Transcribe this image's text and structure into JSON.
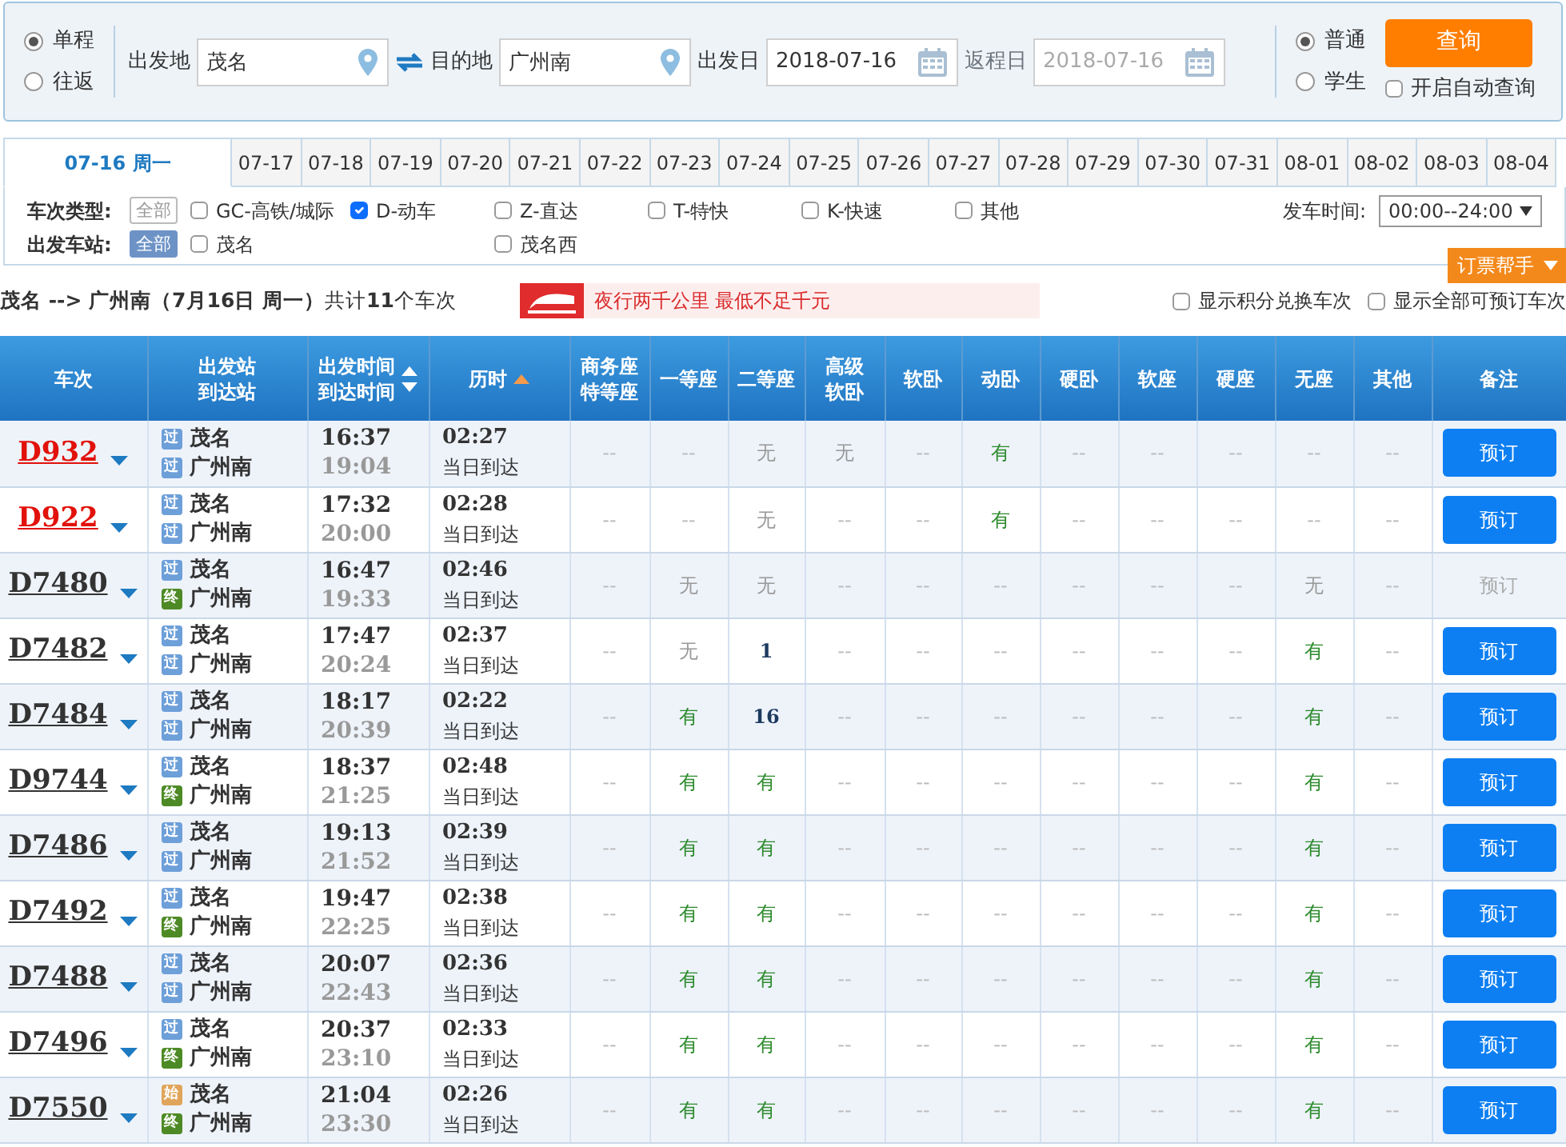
{
  "trip_type": [
    {
      "label": "单程",
      "selected": true
    },
    {
      "label": "往返",
      "selected": false
    }
  ],
  "search": {
    "from_label": "出发地",
    "from_value": "茂名",
    "to_label": "目的地",
    "to_value": "广州南",
    "depart_label": "出发日",
    "depart_value": "2018-07-16",
    "return_label": "返程日",
    "return_value": "2018-07-16",
    "return_disabled": true
  },
  "passenger_type": [
    {
      "label": "普通",
      "selected": true
    },
    {
      "label": "学生",
      "selected": false
    }
  ],
  "query_button": "查询",
  "auto_query": {
    "label": "开启自动查询",
    "checked": false
  },
  "date_tabs": [
    {
      "label": "07-16 周一",
      "selected": true
    },
    {
      "label": "07-17",
      "selected": false
    },
    {
      "label": "07-18",
      "selected": false
    },
    {
      "label": "07-19",
      "selected": false
    },
    {
      "label": "07-20",
      "selected": false
    },
    {
      "label": "07-21",
      "selected": false
    },
    {
      "label": "07-22",
      "selected": false
    },
    {
      "label": "07-23",
      "selected": false
    },
    {
      "label": "07-24",
      "selected": false
    },
    {
      "label": "07-25",
      "selected": false
    },
    {
      "label": "07-26",
      "selected": false
    },
    {
      "label": "07-27",
      "selected": false
    },
    {
      "label": "07-28",
      "selected": false
    },
    {
      "label": "07-29",
      "selected": false
    },
    {
      "label": "07-30",
      "selected": false
    },
    {
      "label": "07-31",
      "selected": false
    },
    {
      "label": "08-01",
      "selected": false
    },
    {
      "label": "08-02",
      "selected": false
    },
    {
      "label": "08-03",
      "selected": false
    },
    {
      "label": "08-04",
      "selected": false
    }
  ],
  "train_filter": {
    "label": "车次类型:",
    "all": {
      "label": "全部",
      "selected": false
    },
    "options": [
      {
        "label": "GC-高铁/城际",
        "checked": false
      },
      {
        "label": "D-动车",
        "checked": true
      },
      {
        "label": "Z-直达",
        "checked": false
      },
      {
        "label": "T-特快",
        "checked": false
      },
      {
        "label": "K-快速",
        "checked": false
      },
      {
        "label": "其他",
        "checked": false
      }
    ]
  },
  "depart_time": {
    "label": "发车时间:",
    "value": "00:00--24:00"
  },
  "station_filter": {
    "label": "出发车站:",
    "all": {
      "label": "全部",
      "selected": true
    },
    "options": [
      {
        "label": "茂名",
        "checked": false
      },
      {
        "label": "茂名西",
        "checked": false
      }
    ]
  },
  "helper_button": "订票帮手",
  "summary": "**茂名 --> 广州南（7月16日  周一）**共计**11**个车次",
  "promo": "夜行两千公里 最低不足千元",
  "display_options": [
    {
      "label": "显示积分兑换车次",
      "checked": false
    },
    {
      "label": "显示全部可预订车次",
      "checked": false
    }
  ],
  "table": {
    "columns": [
      {
        "lines": [
          "车次"
        ]
      },
      {
        "lines": [
          "出发站",
          "到达站"
        ]
      },
      {
        "lines": [
          "出发时间",
          "到达时间"
        ],
        "kind": "sort_both"
      },
      {
        "lines": [
          "历时"
        ],
        "kind": "sort_asc"
      },
      {
        "lines": [
          "商务座",
          "特等座"
        ]
      },
      {
        "lines": [
          "一等座"
        ]
      },
      {
        "lines": [
          "二等座"
        ]
      },
      {
        "lines": [
          "高级",
          "软卧"
        ]
      },
      {
        "lines": [
          "软卧"
        ]
      },
      {
        "lines": [
          "动卧"
        ]
      },
      {
        "lines": [
          "硬卧"
        ]
      },
      {
        "lines": [
          "软座"
        ]
      },
      {
        "lines": [
          "硬座"
        ]
      },
      {
        "lines": [
          "无座"
        ]
      },
      {
        "lines": [
          "其他"
        ]
      },
      {
        "lines": [
          "备注"
        ]
      }
    ],
    "rows": [
      {
        "train": "D932",
        "highlighted": true,
        "from_tag": {
          "text": "过",
          "kind": "pass"
        },
        "from": "茂名",
        "to_tag": {
          "text": "过",
          "kind": "pass"
        },
        "to": "广州南",
        "depart": "16:37",
        "arrive": "19:04",
        "duration": "02:27",
        "arrival_day": "当日到达",
        "seats": [
          {
            "text": "--",
            "kind": "dash"
          },
          {
            "text": "--",
            "kind": "dash"
          },
          {
            "text": "无",
            "kind": "sold_out"
          },
          {
            "text": "无",
            "kind": "sold_out"
          },
          {
            "text": "--",
            "kind": "dash"
          },
          {
            "text": "有",
            "kind": "available"
          },
          {
            "text": "--",
            "kind": "dash"
          },
          {
            "text": "--",
            "kind": "dash"
          },
          {
            "text": "--",
            "kind": "dash"
          },
          {
            "text": "--",
            "kind": "dash"
          },
          {
            "text": "--",
            "kind": "dash"
          }
        ],
        "book_label": "预订",
        "bookable": true
      },
      {
        "train": "D922",
        "highlighted": true,
        "from_tag": {
          "text": "过",
          "kind": "pass"
        },
        "from": "茂名",
        "to_tag": {
          "text": "过",
          "kind": "pass"
        },
        "to": "广州南",
        "depart": "17:32",
        "arrive": "20:00",
        "duration": "02:28",
        "arrival_day": "当日到达",
        "seats": [
          {
            "text": "--",
            "kind": "dash"
          },
          {
            "text": "--",
            "kind": "dash"
          },
          {
            "text": "无",
            "kind": "sold_out"
          },
          {
            "text": "--",
            "kind": "dash"
          },
          {
            "text": "--",
            "kind": "dash"
          },
          {
            "text": "有",
            "kind": "available"
          },
          {
            "text": "--",
            "kind": "dash"
          },
          {
            "text": "--",
            "kind": "dash"
          },
          {
            "text": "--",
            "kind": "dash"
          },
          {
            "text": "--",
            "kind": "dash"
          },
          {
            "text": "--",
            "kind": "dash"
          }
        ],
        "book_label": "预订",
        "bookable": true
      },
      {
        "train": "D7480",
        "highlighted": false,
        "from_tag": {
          "text": "过",
          "kind": "pass"
        },
        "from": "茂名",
        "to_tag": {
          "text": "终",
          "kind": "end"
        },
        "to": "广州南",
        "depart": "16:47",
        "arrive": "19:33",
        "duration": "02:46",
        "arrival_day": "当日到达",
        "seats": [
          {
            "text": "--",
            "kind": "dash"
          },
          {
            "text": "无",
            "kind": "sold_out"
          },
          {
            "text": "无",
            "kind": "sold_out"
          },
          {
            "text": "--",
            "kind": "dash"
          },
          {
            "text": "--",
            "kind": "dash"
          },
          {
            "text": "--",
            "kind": "dash"
          },
          {
            "text": "--",
            "kind": "dash"
          },
          {
            "text": "--",
            "kind": "dash"
          },
          {
            "text": "--",
            "kind": "dash"
          },
          {
            "text": "无",
            "kind": "sold_out"
          },
          {
            "text": "--",
            "kind": "dash"
          }
        ],
        "book_label": "预订",
        "bookable": false
      },
      {
        "train": "D7482",
        "highlighted": false,
        "from_tag": {
          "text": "过",
          "kind": "pass"
        },
        "from": "茂名",
        "to_tag": {
          "text": "过",
          "kind": "pass"
        },
        "to": "广州南",
        "depart": "17:47",
        "arrive": "20:24",
        "duration": "02:37",
        "arrival_day": "当日到达",
        "seats": [
          {
            "text": "--",
            "kind": "dash"
          },
          {
            "text": "无",
            "kind": "sold_out"
          },
          {
            "text": "1",
            "kind": "count"
          },
          {
            "text": "--",
            "kind": "dash"
          },
          {
            "text": "--",
            "kind": "dash"
          },
          {
            "text": "--",
            "kind": "dash"
          },
          {
            "text": "--",
            "kind": "dash"
          },
          {
            "text": "--",
            "kind": "dash"
          },
          {
            "text": "--",
            "kind": "dash"
          },
          {
            "text": "有",
            "kind": "available"
          },
          {
            "text": "--",
            "kind": "dash"
          }
        ],
        "book_label": "预订",
        "bookable": true
      },
      {
        "train": "D7484",
        "highlighted": false,
        "from_tag": {
          "text": "过",
          "kind": "pass"
        },
        "from": "茂名",
        "to_tag": {
          "text": "过",
          "kind": "pass"
        },
        "to": "广州南",
        "depart": "18:17",
        "arrive": "20:39",
        "duration": "02:22",
        "arrival_day": "当日到达",
        "seats": [
          {
            "text": "--",
            "kind": "dash"
          },
          {
            "text": "有",
            "kind": "available"
          },
          {
            "text": "16",
            "kind": "count"
          },
          {
            "text": "--",
            "kind": "dash"
          },
          {
            "text": "--",
            "kind": "dash"
          },
          {
            "text": "--",
            "kind": "dash"
          },
          {
            "text": "--",
            "kind": "dash"
          },
          {
            "text": "--",
            "kind": "dash"
          },
          {
            "text": "--",
            "kind": "dash"
          },
          {
            "text": "有",
            "kind": "available"
          },
          {
            "text": "--",
            "kind": "dash"
          }
        ],
        "book_label": "预订",
        "bookable": true
      },
      {
        "train": "D9744",
        "highlighted": false,
        "from_tag": {
          "text": "过",
          "kind": "pass"
        },
        "from": "茂名",
        "to_tag": {
          "text": "终",
          "kind": "end"
        },
        "to": "广州南",
        "depart": "18:37",
        "arrive": "21:25",
        "duration": "02:48",
        "arrival_day": "当日到达",
        "seats": [
          {
            "text": "--",
            "kind": "dash"
          },
          {
            "text": "有",
            "kind": "available"
          },
          {
            "text": "有",
            "kind": "available"
          },
          {
            "text": "--",
            "kind": "dash"
          },
          {
            "text": "--",
            "kind": "dash"
          },
          {
            "text": "--",
            "kind": "dash"
          },
          {
            "text": "--",
            "kind": "dash"
          },
          {
            "text": "--",
            "kind": "dash"
          },
          {
            "text": "--",
            "kind": "dash"
          },
          {
            "text": "有",
            "kind": "available"
          },
          {
            "text": "--",
            "kind": "dash"
          }
        ],
        "book_label": "预订",
        "bookable": true
      },
      {
        "train": "D7486",
        "highlighted": false,
        "from_tag": {
          "text": "过",
          "kind": "pass"
        },
        "from": "茂名",
        "to_tag": {
          "text": "过",
          "kind": "pass"
        },
        "to": "广州南",
        "depart": "19:13",
        "arrive": "21:52",
        "duration": "02:39",
        "arrival_day": "当日到达",
        "seats": [
          {
            "text": "--",
            "kind": "dash"
          },
          {
            "text": "有",
            "kind": "available"
          },
          {
            "text": "有",
            "kind": "available"
          },
          {
            "text": "--",
            "kind": "dash"
          },
          {
            "text": "--",
            "kind": "dash"
          },
          {
            "text": "--",
            "kind": "dash"
          },
          {
            "text": "--",
            "kind": "dash"
          },
          {
            "text": "--",
            "kind": "dash"
          },
          {
            "text": "--",
            "kind": "dash"
          },
          {
            "text": "有",
            "kind": "available"
          },
          {
            "text": "--",
            "kind": "dash"
          }
        ],
        "book_label": "预订",
        "bookable": true
      },
      {
        "train": "D7492",
        "highlighted": false,
        "from_tag": {
          "text": "过",
          "kind": "pass"
        },
        "from": "茂名",
        "to_tag": {
          "text": "终",
          "kind": "end"
        },
        "to": "广州南",
        "depart": "19:47",
        "arrive": "22:25",
        "duration": "02:38",
        "arrival_day": "当日到达",
        "seats": [
          {
            "text": "--",
            "kind": "dash"
          },
          {
            "text": "有",
            "kind": "available"
          },
          {
            "text": "有",
            "kind": "available"
          },
          {
            "text": "--",
            "kind": "dash"
          },
          {
            "text": "--",
            "kind": "dash"
          },
          {
            "text": "--",
            "kind": "dash"
          },
          {
            "text": "--",
            "kind": "dash"
          },
          {
            "text": "--",
            "kind": "dash"
          },
          {
            "text": "--",
            "kind": "dash"
          },
          {
            "text": "有",
            "kind": "available"
          },
          {
            "text": "--",
            "kind": "dash"
          }
        ],
        "book_label": "预订",
        "bookable": true
      },
      {
        "train": "D7488",
        "highlighted": false,
        "from_tag": {
          "text": "过",
          "kind": "pass"
        },
        "from": "茂名",
        "to_tag": {
          "text": "过",
          "kind": "pass"
        },
        "to": "广州南",
        "depart": "20:07",
        "arrive": "22:43",
        "duration": "02:36",
        "arrival_day": "当日到达",
        "seats": [
          {
            "text": "--",
            "kind": "dash"
          },
          {
            "text": "有",
            "kind": "available"
          },
          {
            "text": "有",
            "kind": "available"
          },
          {
            "text": "--",
            "kind": "dash"
          },
          {
            "text": "--",
            "kind": "dash"
          },
          {
            "text": "--",
            "kind": "dash"
          },
          {
            "text": "--",
            "kind": "dash"
          },
          {
            "text": "--",
            "kind": "dash"
          },
          {
            "text": "--",
            "kind": "dash"
          },
          {
            "text": "有",
            "kind": "available"
          },
          {
            "text": "--",
            "kind": "dash"
          }
        ],
        "book_label": "预订",
        "bookable": true
      },
      {
        "train": "D7496",
        "highlighted": false,
        "from_tag": {
          "text": "过",
          "kind": "pass"
        },
        "from": "茂名",
        "to_tag": {
          "text": "终",
          "kind": "end"
        },
        "to": "广州南",
        "depart": "20:37",
        "arrive": "23:10",
        "duration": "02:33",
        "arrival_day": "当日到达",
        "seats": [
          {
            "text": "--",
            "kind": "dash"
          },
          {
            "text": "有",
            "kind": "available"
          },
          {
            "text": "有",
            "kind": "available"
          },
          {
            "text": "--",
            "kind": "dash"
          },
          {
            "text": "--",
            "kind": "dash"
          },
          {
            "text": "--",
            "kind": "dash"
          },
          {
            "text": "--",
            "kind": "dash"
          },
          {
            "text": "--",
            "kind": "dash"
          },
          {
            "text": "--",
            "kind": "dash"
          },
          {
            "text": "有",
            "kind": "available"
          },
          {
            "text": "--",
            "kind": "dash"
          }
        ],
        "book_label": "预订",
        "bookable": true
      },
      {
        "train": "D7550",
        "highlighted": false,
        "from_tag": {
          "text": "始",
          "kind": "start"
        },
        "from": "茂名",
        "to_tag": {
          "text": "终",
          "kind": "end"
        },
        "to": "广州南",
        "depart": "21:04",
        "arrive": "23:30",
        "duration": "02:26",
        "arrival_day": "当日到达",
        "seats": [
          {
            "text": "--",
            "kind": "dash"
          },
          {
            "text": "有",
            "kind": "available"
          },
          {
            "text": "有",
            "kind": "available"
          },
          {
            "text": "--",
            "kind": "dash"
          },
          {
            "text": "--",
            "kind": "dash"
          },
          {
            "text": "--",
            "kind": "dash"
          },
          {
            "text": "--",
            "kind": "dash"
          },
          {
            "text": "--",
            "kind": "dash"
          },
          {
            "text": "--",
            "kind": "dash"
          },
          {
            "text": "有",
            "kind": "available"
          },
          {
            "text": "--",
            "kind": "dash"
          }
        ],
        "book_label": "预订",
        "bookable": true
      }
    ]
  }
}
